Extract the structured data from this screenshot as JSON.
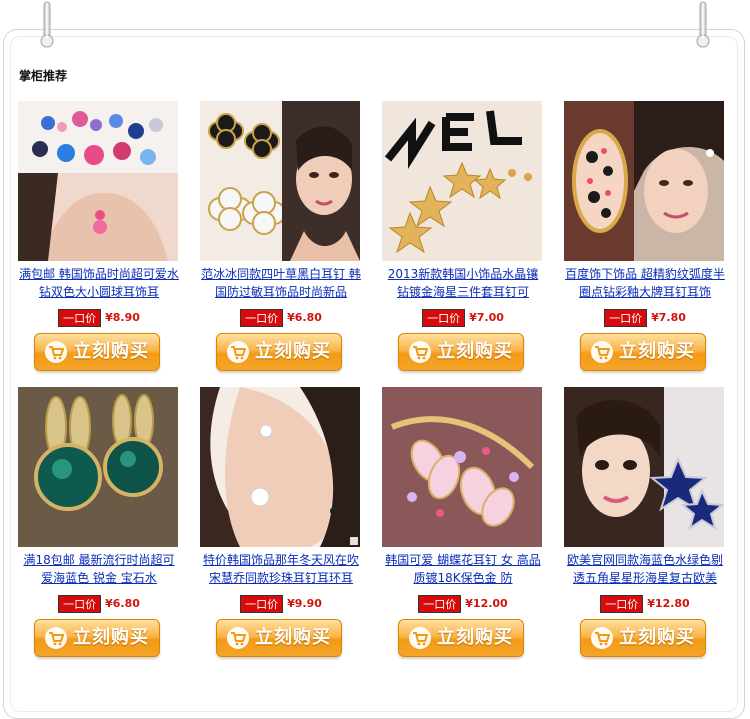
{
  "section": {
    "title": "掌柜推荐"
  },
  "colors": {
    "link": "#0b2db8",
    "price": "#d2140c",
    "tag_bg": "#d70b0b",
    "button": "#f39a16"
  },
  "products": [
    {
      "title": "满包邮 韩国饰品时尚超可爱水钻双色大小圆球耳饰耳",
      "tag": "一口价",
      "price": "¥8.90",
      "button": "立刻购买"
    },
    {
      "title": "范冰冰同款四叶草黑白耳钉 韩国防过敏耳饰品时尚新品",
      "tag": "一口价",
      "price": "¥6.80",
      "button": "立刻购买"
    },
    {
      "title": "2013新款韩国小饰品水晶镶钻镀金海星三件套耳钉可",
      "tag": "一口价",
      "price": "¥7.00",
      "button": "立刻购买"
    },
    {
      "title": "百度饰下饰品 超精豹纹弧度半圈点钻彩釉大牌耳钉耳饰",
      "tag": "一口价",
      "price": "¥7.80",
      "button": "立刻购买"
    },
    {
      "title": "满18包邮 最新流行时尚超可爱海蓝色 锐金 宝石水",
      "tag": "一口价",
      "price": "¥6.80",
      "button": "立刻购买"
    },
    {
      "title": "特价韩国饰品那年冬天风在吹宋慧乔同款珍珠耳钉耳环耳",
      "tag": "一口价",
      "price": "¥9.90",
      "button": "立刻购买"
    },
    {
      "title": "韩国可爱 蝴蝶花耳钉 女 高品质镀18K保色金 防",
      "tag": "一口价",
      "price": "¥12.00",
      "button": "立刻购买"
    },
    {
      "title": "欧美官网同款海蓝色水绿色剔透五角星星形海星复古欧美",
      "tag": "一口价",
      "price": "¥12.80",
      "button": "立刻购买"
    }
  ],
  "icons": {
    "pin": "binder-pin-icon",
    "cart": "shopping-cart-icon"
  }
}
